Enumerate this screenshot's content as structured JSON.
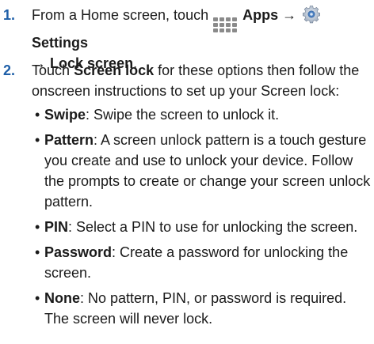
{
  "step1": {
    "number": "1.",
    "text_intro": "From a Home screen, touch",
    "apps_label": "Apps",
    "arrow1": "→",
    "settings_label": "Settings",
    "arrow2": "→",
    "lock_screen_label": "Lock screen",
    "period": "."
  },
  "step2": {
    "number": "2.",
    "text_intro": "Touch",
    "screen_lock_label": "Screen lock",
    "text_rest": "for these options then follow the onscreen instructions to set up your Screen lock:",
    "options": [
      {
        "term": "Swipe",
        "desc": ": Swipe the screen to unlock it."
      },
      {
        "term": "Pattern",
        "desc": ": A screen unlock pattern is a touch gesture you create and use to unlock your device. Follow the prompts to create or change your screen unlock pattern."
      },
      {
        "term": "PIN",
        "desc": ": Select a PIN to use for unlocking the screen."
      },
      {
        "term": "Password",
        "desc": ": Create a password for unlocking the screen."
      },
      {
        "term": "None",
        "desc": ": No pattern, PIN, or password is required. The screen will never lock."
      }
    ]
  },
  "colors": {
    "step_number": "#1e5fa8",
    "text": "#1a1a1a",
    "apps_icon": "#8a8a8a",
    "settings_icon": "#4a7fc1"
  },
  "icons": {
    "apps": "apps-grid-icon",
    "settings": "gear-icon"
  }
}
